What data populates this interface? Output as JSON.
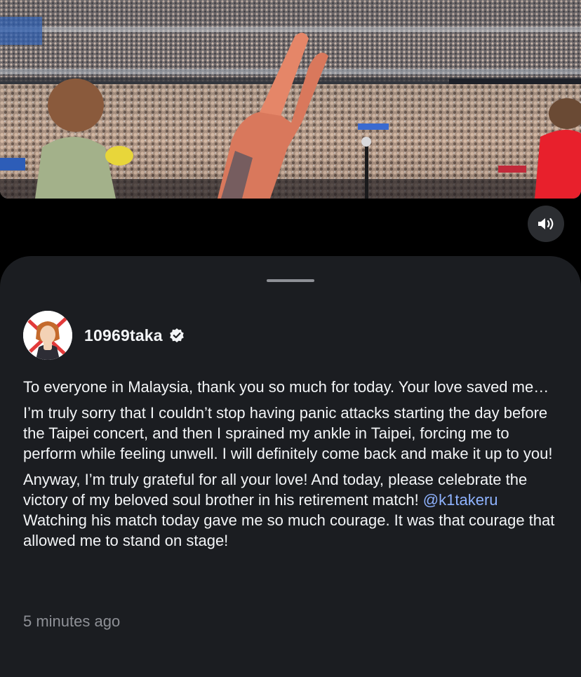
{
  "video": {
    "description_icon": "concert-crowd-photo"
  },
  "controls": {
    "mute_icon": "speaker-volume-icon"
  },
  "post": {
    "username": "10969taka",
    "verified_icon": "verified-badge-icon",
    "paragraphs": {
      "p1": "To everyone in Malaysia, thank you so much for today. Your love saved me…",
      "p2": "I’m truly sorry that I couldn’t stop having panic attacks starting the day before the Taipei concert, and then I sprained my ankle in Taipei, forcing me to perform while feeling unwell. I will definitely come back and make it up to you!",
      "p3_before": "Anyway, I’m truly grateful for all your love! And today, please celebrate the victory of my beloved soul brother in his retirement match! ",
      "p3_mention": "@k1takeru",
      "p3_after": " Watching his match today gave me so much courage. It was that courage that allowed me to stand on stage!"
    },
    "timestamp": "5 minutes ago"
  },
  "colors": {
    "background": "#000000",
    "sheet": "#1b1d21",
    "text": "#f3f5f7",
    "muted": "#8e9096",
    "mention": "#8fb3ff"
  }
}
